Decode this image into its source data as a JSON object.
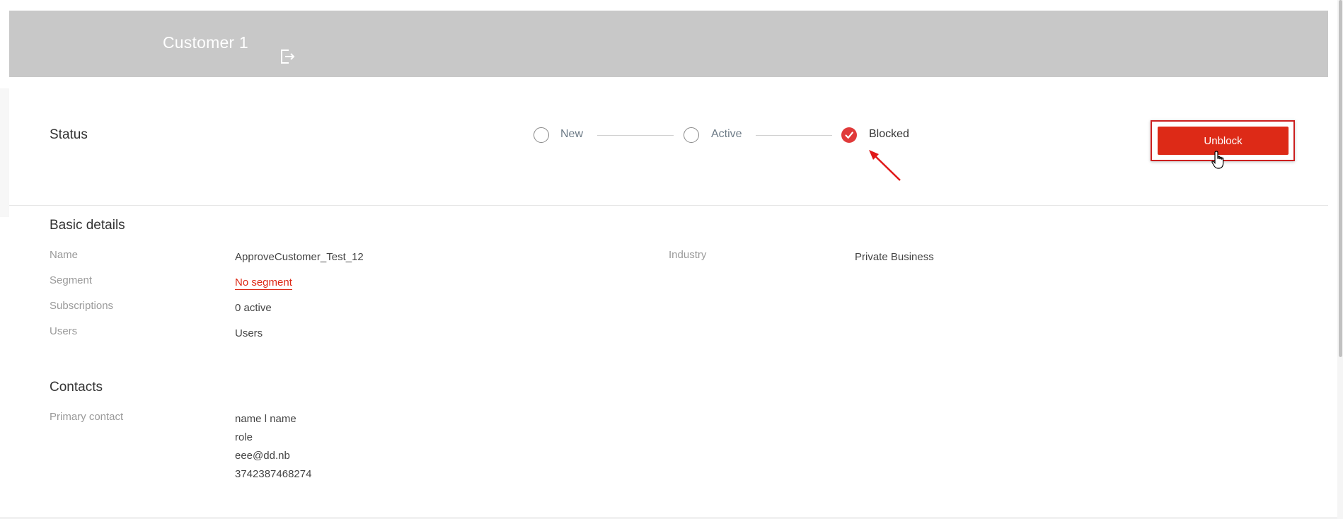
{
  "header": {
    "title": "Customer 1",
    "exit_icon": "logout-icon",
    "background": "#c8c8c8"
  },
  "status": {
    "label": "Status",
    "steps": [
      {
        "label": "New",
        "checked": false
      },
      {
        "label": "Active",
        "checked": false
      },
      {
        "label": "Blocked",
        "checked": true
      }
    ],
    "action_label": "Unblock",
    "accent": "#dd2a17"
  },
  "basic_details": {
    "title": "Basic details",
    "fields": {
      "name": {
        "label": "Name",
        "value": "ApproveCustomer_Test_12"
      },
      "segment": {
        "label": "Segment",
        "value": "No segment"
      },
      "subscriptions": {
        "label": "Subscriptions",
        "value": "0 active"
      },
      "users": {
        "label": "Users",
        "value": "Users"
      },
      "industry": {
        "label": "Industry",
        "value": "Private Business"
      }
    }
  },
  "contacts": {
    "title": "Contacts",
    "primary_label": "Primary contact",
    "primary_lines": [
      "name l name",
      "role",
      "eee@dd.nb",
      "3742387468274"
    ]
  }
}
